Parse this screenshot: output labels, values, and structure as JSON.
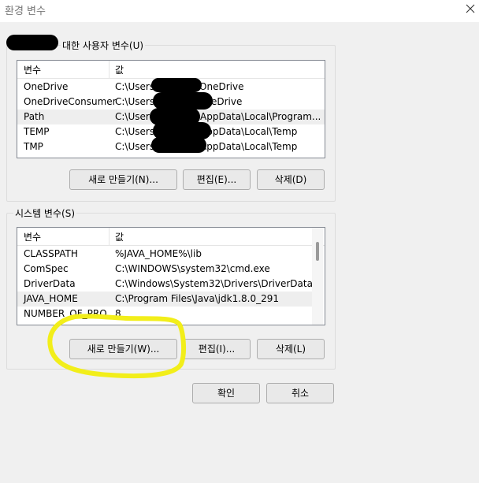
{
  "window": {
    "title": "환경 변수",
    "close_icon": "close-icon"
  },
  "user_vars": {
    "label": "대한 사용자 변수(U)",
    "columns": [
      "변수",
      "값"
    ],
    "rows": [
      {
        "name": "OneDrive",
        "value": "C:\\Users",
        "value_tail": "\\OneDrive"
      },
      {
        "name": "OneDriveConsumer",
        "value": "C:\\Users",
        "value_tail": "eDrive"
      },
      {
        "name": "Path",
        "value": "C:\\Users",
        "value_tail": "AppData\\Local\\Program..."
      },
      {
        "name": "TEMP",
        "value": "C:\\Users",
        "value_tail": "\\AppData\\Local\\Temp"
      },
      {
        "name": "TMP",
        "value": "C:\\Users",
        "value_tail": "\\AppData\\Local\\Temp"
      }
    ],
    "buttons": {
      "new": "새로 만들기(N)...",
      "edit": "편집(E)...",
      "delete": "삭제(D)"
    }
  },
  "system_vars": {
    "label": "시스템 변수(S)",
    "columns": [
      "변수",
      "값"
    ],
    "rows": [
      {
        "name": "CLASSPATH",
        "value": "%JAVA_HOME%\\lib"
      },
      {
        "name": "ComSpec",
        "value": "C:\\WINDOWS\\system32\\cmd.exe"
      },
      {
        "name": "DriverData",
        "value": "C:\\Windows\\System32\\Drivers\\DriverData"
      },
      {
        "name": "JAVA_HOME",
        "value": "C:\\Program Files\\Java\\jdk1.8.0_291"
      },
      {
        "name": "NUMBER_OF_PRO...",
        "value": "8"
      }
    ],
    "buttons": {
      "new": "새로 만들기(W)...",
      "edit": "편집(I)...",
      "delete": "삭제(L)"
    }
  },
  "footer": {
    "ok": "확인",
    "cancel": "취소"
  },
  "colors": {
    "annotation": "#f2ee1a",
    "redaction": "#000000",
    "selected_row": "#eeeeee"
  }
}
